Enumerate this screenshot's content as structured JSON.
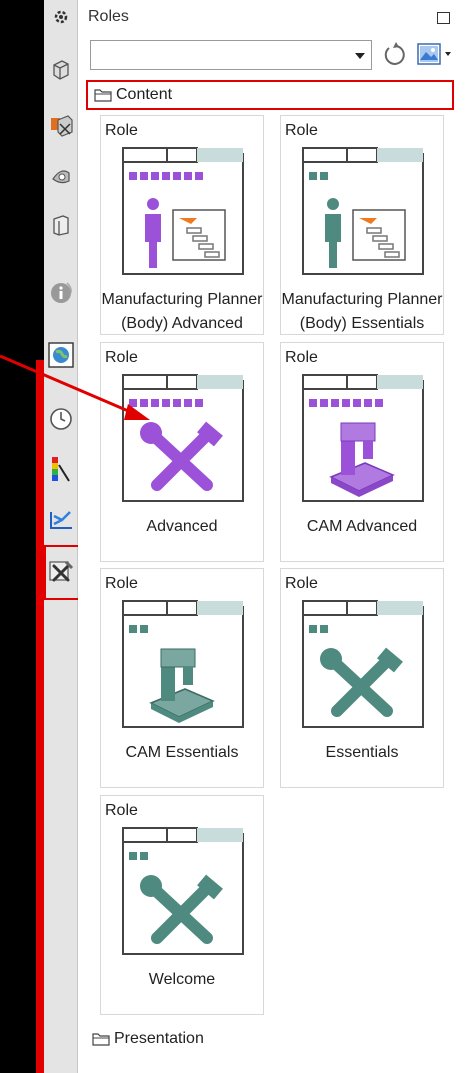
{
  "panel": {
    "title": "Roles",
    "combo_value": "",
    "groups": {
      "content": "Content",
      "presentation": "Presentation"
    }
  },
  "rail": {
    "icons": [
      "gear-icon",
      "part-icon",
      "assembly-icon",
      "drafting-icon",
      "book-icon",
      "info-icon",
      "globe-icon",
      "clock-icon",
      "color-icon",
      "graph-icon",
      "roles-icon"
    ]
  },
  "cards": [
    {
      "type": "Role",
      "name": "Manufacturing Planner (Body) Advanced",
      "name_l1": "Manufacturing Planner",
      "name_l2": "(Body) Advanced"
    },
    {
      "type": "Role",
      "name": "Manufacturing Planner (Body) Essentials",
      "name_l1": "Manufacturing Planner",
      "name_l2": "(Body) Essentials"
    },
    {
      "type": "Role",
      "name": "Advanced"
    },
    {
      "type": "Role",
      "name": "CAM Advanced"
    },
    {
      "type": "Role",
      "name": "CAM Essentials"
    },
    {
      "type": "Role",
      "name": "Essentials"
    },
    {
      "type": "Role",
      "name": "Welcome"
    }
  ],
  "colors": {
    "accent_purple": "#9b52d8",
    "teal": "#4f8a80",
    "annotation_red": "#e00000"
  }
}
